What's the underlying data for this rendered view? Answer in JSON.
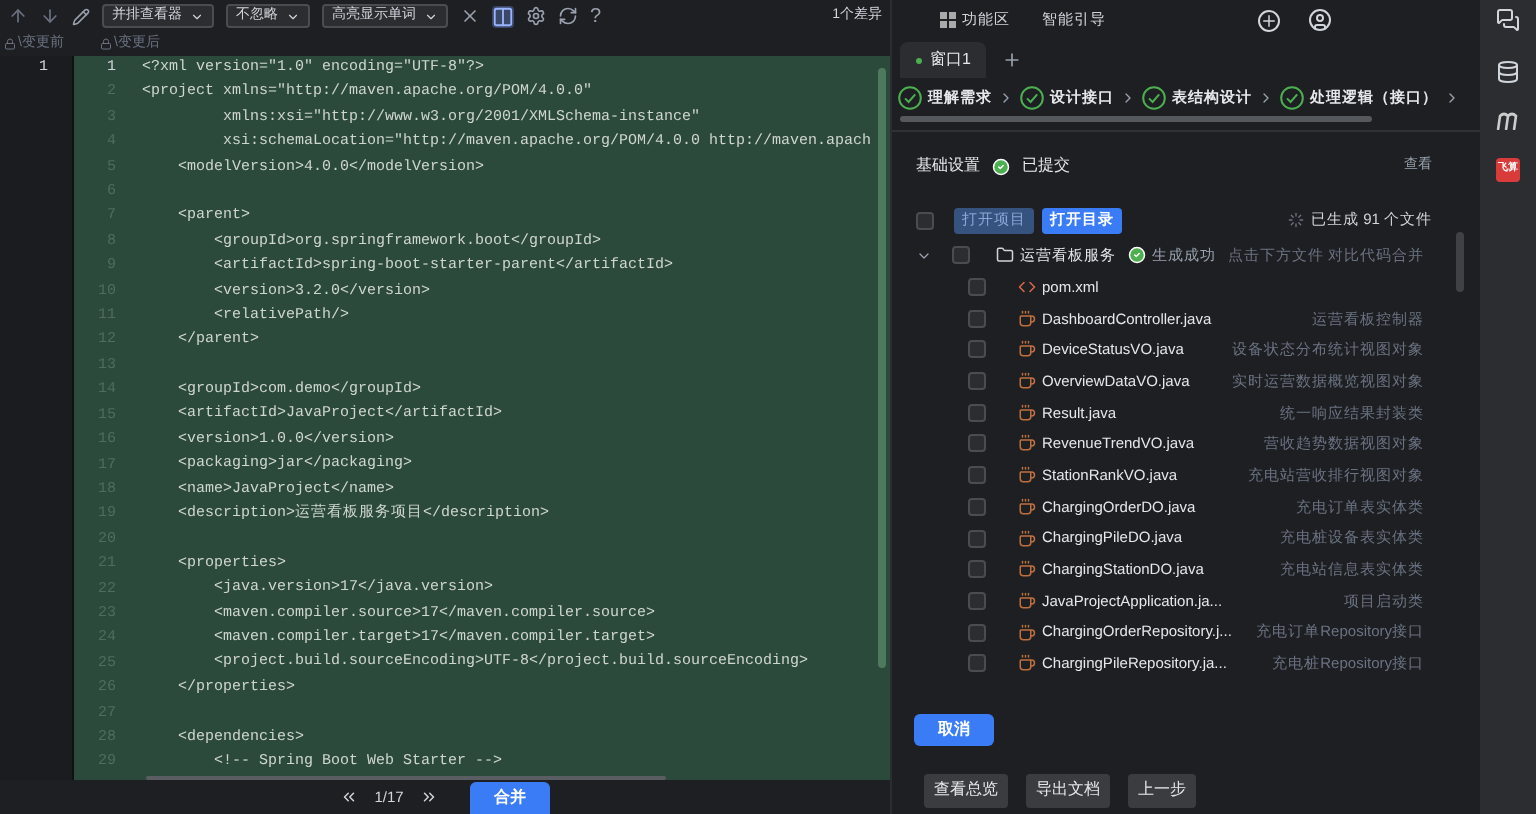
{
  "toolbar": {
    "dropdowns": [
      "并排查看器",
      "不忽略",
      "高亮显示单词"
    ],
    "help": "?",
    "diff_count": "1个差异"
  },
  "panes": {
    "before": "\\变更前",
    "after": "\\变更后"
  },
  "editor": {
    "old_line_numbers": [
      "1"
    ],
    "lines": [
      {
        "number": "1",
        "text": "<?xml version=\"1.0\" encoding=\"UTF-8\"?>"
      },
      {
        "number": "2",
        "text": "<project xmlns=\"http://maven.apache.org/POM/4.0.0\""
      },
      {
        "number": "3",
        "text": "         xmlns:xsi=\"http://www.w3.org/2001/XMLSchema-instance\""
      },
      {
        "number": "4",
        "text": "         xsi:schemaLocation=\"http://maven.apache.org/POM/4.0.0 http://maven.apach"
      },
      {
        "number": "5",
        "text": "    <modelVersion>4.0.0</modelVersion>"
      },
      {
        "number": "6"
      },
      {
        "number": "7",
        "text": "    <parent>"
      },
      {
        "number": "8",
        "text": "        <groupId>org.springframework.boot</groupId>"
      },
      {
        "number": "9",
        "text": "        <artifactId>spring-boot-starter-parent</artifactId>"
      },
      {
        "number": "10",
        "text": "        <version>3.2.0</version>"
      },
      {
        "number": "11",
        "text": "        <relativePath/>"
      },
      {
        "number": "12",
        "text": "    </parent>"
      },
      {
        "number": "13"
      },
      {
        "number": "14",
        "text": "    <groupId>com.demo</groupId>"
      },
      {
        "number": "15",
        "text": "    <artifactId>JavaProject</artifactId>"
      },
      {
        "number": "16",
        "text": "    <version>1.0.0</version>"
      },
      {
        "number": "17",
        "text": "    <packaging>jar</packaging>"
      },
      {
        "number": "18",
        "text": "    <name>JavaProject</name>"
      },
      {
        "number": "19",
        "text": "    <description>运营看板服务项目</description>"
      },
      {
        "number": "20"
      },
      {
        "number": "21",
        "text": "    <properties>"
      },
      {
        "number": "22",
        "text": "        <java.version>17</java.version>"
      },
      {
        "number": "23",
        "text": "        <maven.compiler.source>17</maven.compiler.source>"
      },
      {
        "number": "24",
        "text": "        <maven.compiler.target>17</maven.compiler.target>"
      },
      {
        "number": "25",
        "text": "        <project.build.sourceEncoding>UTF-8</project.build.sourceEncoding>"
      },
      {
        "number": "26",
        "text": "    </properties>"
      },
      {
        "number": "27"
      },
      {
        "number": "28",
        "text": "    <dependencies>"
      },
      {
        "number": "29",
        "text": "        <!-- Spring Boot Web Starter -->"
      }
    ]
  },
  "pager": {
    "position": "1/17",
    "merge_button": "合并"
  },
  "panel": {
    "header_tabs": [
      "功能区",
      "智能引导"
    ],
    "windows": [
      {
        "label": "窗口1",
        "selected": true
      }
    ],
    "steps": [
      {
        "label": "理解需求",
        "checked": true
      },
      {
        "label": "设计接口",
        "checked": true
      },
      {
        "label": "表结构设计",
        "checked": true
      },
      {
        "label": "处理逻辑（接口）",
        "checked": true
      }
    ],
    "settings": {
      "title": "基础设置",
      "status": "已提交",
      "link": "查看"
    },
    "actions": [
      {
        "label": "打开项目",
        "disabled": true
      },
      {
        "label": "打开目录",
        "disabled": false
      }
    ],
    "select_all_checked": false,
    "generated": "已生成 91 个文件",
    "tree": {
      "name": "运营看板服务",
      "expanded": true,
      "checked": false,
      "status": "生成成功",
      "hint": "点击下方文件 对比代码合并",
      "children": [
        {
          "name": "pom.xml",
          "kind": "xml",
          "checked": false
        },
        {
          "name": "DashboardController.java",
          "kind": "java",
          "description": "运营看板控制器",
          "checked": false
        },
        {
          "name": "DeviceStatusVO.java",
          "kind": "java",
          "description": "设备状态分布统计视图对象",
          "checked": false
        },
        {
          "name": "OverviewDataVO.java",
          "kind": "java",
          "description": "实时运营数据概览视图对象",
          "checked": false
        },
        {
          "name": "Result.java",
          "kind": "java",
          "description": "统一响应结果封装类",
          "checked": false
        },
        {
          "name": "RevenueTrendVO.java",
          "kind": "java",
          "description": "营收趋势数据视图对象",
          "checked": false
        },
        {
          "name": "StationRankVO.java",
          "kind": "java",
          "description": "充电站营收排行视图对象",
          "checked": false
        },
        {
          "name": "ChargingOrderDO.java",
          "kind": "java",
          "description": "充电订单表实体类",
          "checked": false
        },
        {
          "name": "ChargingPileDO.java",
          "kind": "java",
          "description": "充电桩设备表实体类",
          "checked": false
        },
        {
          "name": "ChargingStationDO.java",
          "kind": "java",
          "description": "充电站信息表实体类",
          "checked": false
        },
        {
          "name": "JavaProjectApplication.ja...",
          "kind": "java",
          "description": "项目启动类",
          "checked": false
        },
        {
          "name": "ChargingOrderRepository.j...",
          "kind": "java",
          "description": "充电订单Repository接口",
          "checked": false
        },
        {
          "name": "ChargingPileRepository.ja...",
          "kind": "java",
          "description": "充电桩Repository接口",
          "checked": false
        }
      ]
    },
    "cancel_button": "取消",
    "footer_buttons": [
      "查看总览",
      "导出文档",
      "上一步"
    ]
  },
  "sidebar": {
    "badge": "飞算"
  }
}
